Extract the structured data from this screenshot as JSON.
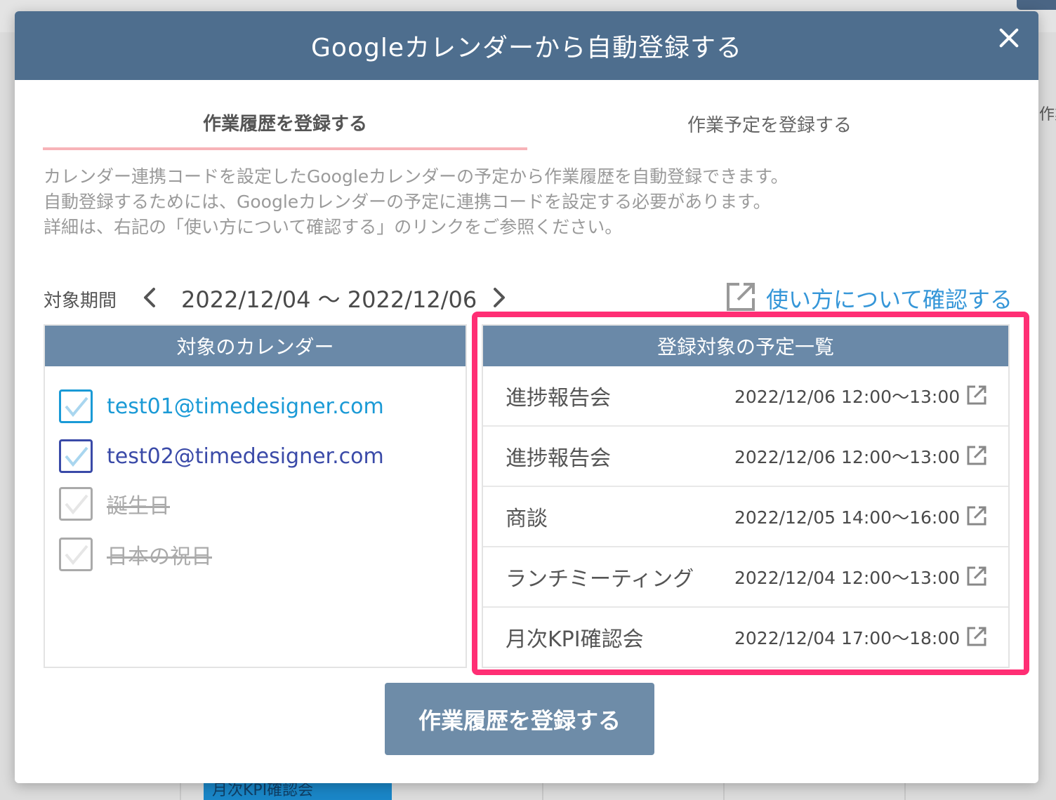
{
  "background": {
    "side_text": "作業",
    "event_label": "月次KPI確認会"
  },
  "modal": {
    "title": "Googleカレンダーから自動登録する",
    "close_icon": "close-icon"
  },
  "tabs": [
    {
      "label": "作業履歴を登録する",
      "active": true
    },
    {
      "label": "作業予定を登録する",
      "active": false
    }
  ],
  "description": {
    "line1": "カレンダー連携コードを設定したGoogleカレンダーの予定から作業履歴を自動登録できます。",
    "line2": "自動登録するためには、Googleカレンダーの予定に連携コードを設定する必要があります。",
    "line3": "詳細は、右記の「使い方について確認する」のリンクをご参照ください。"
  },
  "period": {
    "label": "対象期間",
    "range": "2022/12/04 〜 2022/12/06"
  },
  "help_link": {
    "label": "使い方について確認する",
    "icon": "external-link-icon"
  },
  "calendars": {
    "header": "対象のカレンダー",
    "items": [
      {
        "label": "test01@timedesigner.com",
        "checked": true,
        "color": "#1a9ad6"
      },
      {
        "label": "test02@timedesigner.com",
        "checked": true,
        "color": "#3a4aa8"
      },
      {
        "label": "誕生日",
        "checked": false,
        "color": "#aaaaaa"
      },
      {
        "label": "日本の祝日",
        "checked": false,
        "color": "#aaaaaa"
      }
    ]
  },
  "events": {
    "header": "登録対象の予定一覧",
    "items": [
      {
        "name": "進捗報告会",
        "time": "2022/12/06 12:00〜13:00"
      },
      {
        "name": "進捗報告会",
        "time": "2022/12/06 12:00〜13:00"
      },
      {
        "name": "商談",
        "time": "2022/12/05 14:00〜16:00"
      },
      {
        "name": "ランチミーティング",
        "time": "2022/12/04 12:00〜13:00"
      },
      {
        "name": "月次KPI確認会",
        "time": "2022/12/04 17:00〜18:00"
      }
    ]
  },
  "submit_button": {
    "label": "作業履歴を登録する"
  },
  "colors": {
    "header": "#4e6e8e",
    "panel_header": "#6a89a8",
    "highlight": "#ff2e74",
    "link": "#3596d8",
    "tab_underline": "#f7b3b8",
    "button": "#6e8ca8"
  }
}
